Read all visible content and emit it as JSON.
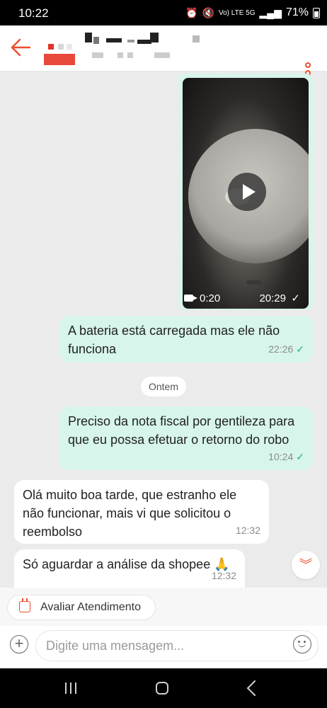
{
  "status_bar": {
    "time": "10:22",
    "signal_labels": "Vo) LTE 5G",
    "battery": "71%"
  },
  "header": {},
  "video_message": {
    "duration": "0:20",
    "time": "20:29"
  },
  "messages": [
    {
      "direction": "out",
      "text": "A bateria está carregada mas ele não funciona",
      "time": "22:26",
      "read": "✓"
    },
    {
      "direction": "out",
      "text": "Preciso da nota fiscal por gentileza para que eu possa efetuar o retorno do robo",
      "time": "10:24",
      "read": "✓"
    },
    {
      "direction": "in",
      "text": "Olá muito boa tarde, que estranho ele não funcionar, mais vi que solicitou o reembolso",
      "time": "12:32"
    },
    {
      "direction": "in",
      "text": "Só aguardar a análise da shopee 🙏",
      "time": "12:32"
    }
  ],
  "date_separator": "Ontem",
  "rate_button": {
    "label": "Avaliar Atendimento"
  },
  "composer": {
    "placeholder": "Digite uma mensagem..."
  },
  "colors": {
    "accent": "#ee4d2d",
    "outgoing_bubble": "#d7f5ea",
    "incoming_bubble": "#ffffff",
    "background": "#ebebeb",
    "read_tick": "#26aa99"
  }
}
